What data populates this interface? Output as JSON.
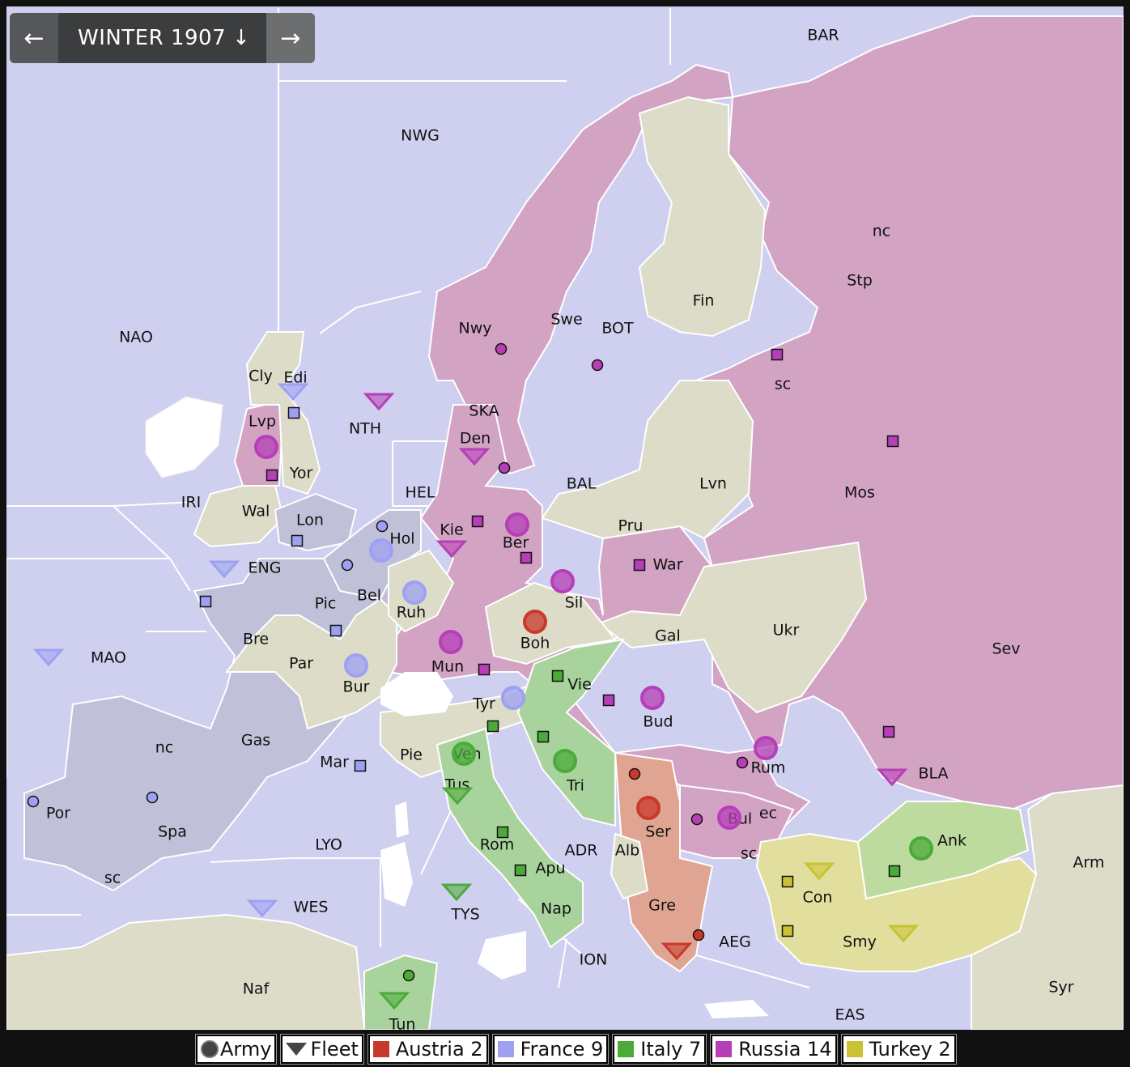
{
  "nav": {
    "prev_icon": "arrow-left-icon",
    "phase": "WINTER 1907",
    "phase_arrow": "↓",
    "next_icon": "arrow-right-icon",
    "prev_glyph": "←",
    "next_glyph": "→"
  },
  "colors": {
    "sea": "#cfd0ef",
    "neutral": "#dcdcc8",
    "austria": "#c8392b",
    "france": "#9ea1f2",
    "italy": "#4caa3a",
    "russia": "#b63fb8",
    "turkey": "#c9c235",
    "russia_land": "#d3a3c4",
    "france_land": "#c0c0d8",
    "italy_land": "#a9d39c",
    "austria_land": "#e0a592",
    "turkey_land": "#e2df9e",
    "turkey_land2": "#bedb9f"
  },
  "labels": [
    "NWG",
    "BAR",
    "NAO",
    "Nwy",
    "Swe",
    "BOT",
    "Fin",
    "Stp",
    "nc",
    "sc",
    "Mos",
    "Cly",
    "Edi",
    "Lvp",
    "Yor",
    "NTH",
    "SKA",
    "Den",
    "HEL",
    "BAL",
    "Lvn",
    "IRI",
    "Wal",
    "Lon",
    "Hol",
    "Kie",
    "Ber",
    "Pru",
    "War",
    "ENG",
    "Bel",
    "Ruh",
    "Pic",
    "Bre",
    "Par",
    "Bur",
    "Mun",
    "Boh",
    "Sil",
    "Gal",
    "Ukr",
    "Sev",
    "MAO",
    "Gas",
    "Tyr",
    "Vie",
    "Bud",
    "Rum",
    "BLA",
    "Mar",
    "Pie",
    "Ven",
    "Tri",
    "Ser",
    "Bul",
    "ec",
    "Ank",
    "Arm",
    "Por",
    "Spa",
    "LYO",
    "Tus",
    "Rom",
    "Apu",
    "ADR",
    "Alb",
    "Con",
    "Gre",
    "AEG",
    "Smy",
    "WES",
    "TYS",
    "Nap",
    "ION",
    "Naf",
    "Tun",
    "EAS",
    "Syr"
  ],
  "legend": {
    "army": "Army",
    "fleet": "Fleet",
    "powers": [
      {
        "name": "Austria 2",
        "color": "#c8392b"
      },
      {
        "name": "France 9",
        "color": "#9ea1f2"
      },
      {
        "name": "Italy 7",
        "color": "#4caa3a"
      },
      {
        "name": "Russia 14",
        "color": "#b63fb8"
      },
      {
        "name": "Turkey 2",
        "color": "#c9c235"
      }
    ]
  },
  "units": [
    {
      "type": "army",
      "power": "russia",
      "province": "Lvp"
    },
    {
      "type": "army",
      "power": "russia",
      "province": "Ber"
    },
    {
      "type": "army",
      "power": "russia",
      "province": "Sil"
    },
    {
      "type": "army",
      "power": "russia",
      "province": "Mun"
    },
    {
      "type": "army",
      "power": "russia",
      "province": "Bud"
    },
    {
      "type": "army",
      "power": "russia",
      "province": "Rum"
    },
    {
      "type": "army",
      "power": "russia",
      "province": "Bul"
    },
    {
      "type": "army",
      "power": "france",
      "province": "Hol"
    },
    {
      "type": "army",
      "power": "france",
      "province": "Ruh"
    },
    {
      "type": "army",
      "power": "france",
      "province": "Bur"
    },
    {
      "type": "army",
      "power": "france",
      "province": "Tyr"
    },
    {
      "type": "army",
      "power": "austria",
      "province": "Boh"
    },
    {
      "type": "army",
      "power": "austria",
      "province": "Ser"
    },
    {
      "type": "army",
      "power": "italy",
      "province": "Ven"
    },
    {
      "type": "army",
      "power": "italy",
      "province": "Tri"
    },
    {
      "type": "army",
      "power": "italy",
      "province": "Ank"
    },
    {
      "type": "fleet",
      "power": "france",
      "province": "Edi"
    },
    {
      "type": "fleet",
      "power": "france",
      "province": "ENG"
    },
    {
      "type": "fleet",
      "power": "france",
      "province": "MAO"
    },
    {
      "type": "fleet",
      "power": "france",
      "province": "WES"
    },
    {
      "type": "fleet",
      "power": "russia",
      "province": "NTH"
    },
    {
      "type": "fleet",
      "power": "russia",
      "province": "Den"
    },
    {
      "type": "fleet",
      "power": "russia",
      "province": "Kie"
    },
    {
      "type": "fleet",
      "power": "russia",
      "province": "BLA"
    },
    {
      "type": "fleet",
      "power": "italy",
      "province": "Tus"
    },
    {
      "type": "fleet",
      "power": "italy",
      "province": "TYS"
    },
    {
      "type": "fleet",
      "power": "italy",
      "province": "Tun"
    },
    {
      "type": "fleet",
      "power": "austria",
      "province": "AEG"
    },
    {
      "type": "fleet",
      "power": "turkey",
      "province": "Con"
    },
    {
      "type": "fleet",
      "power": "turkey",
      "province": "Smy"
    }
  ]
}
